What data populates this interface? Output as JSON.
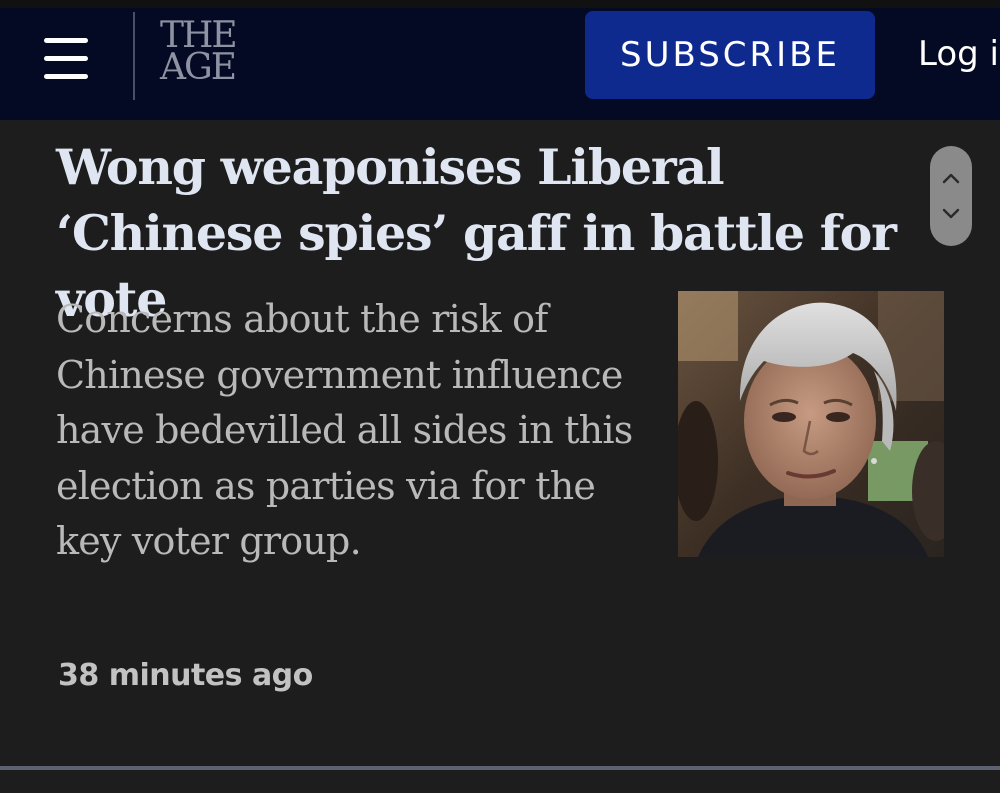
{
  "header": {
    "logo_line1": "THE",
    "logo_line2": "AGE",
    "subscribe_label": "SUBSCRIBE",
    "login_label": "Log in"
  },
  "article": {
    "headline": "Wong weaponises Liberal ‘Chinese spies’ gaff in battle for vote",
    "summary": "Concerns about the risk of Chinese government influence have bedevilled all sides in this election as parties via for the key voter group.",
    "timestamp": "38 minutes ago"
  },
  "icons": {
    "menu": "hamburger-menu-icon",
    "scroll_up": "chevron-up-icon",
    "scroll_down": "chevron-down-icon"
  },
  "colors": {
    "header_bg": "#050a24",
    "subscribe_bg": "#0f2a8f",
    "page_bg": "#1d1d1d",
    "headline": "#dfe5f1",
    "summary": "#b9b9b9"
  }
}
